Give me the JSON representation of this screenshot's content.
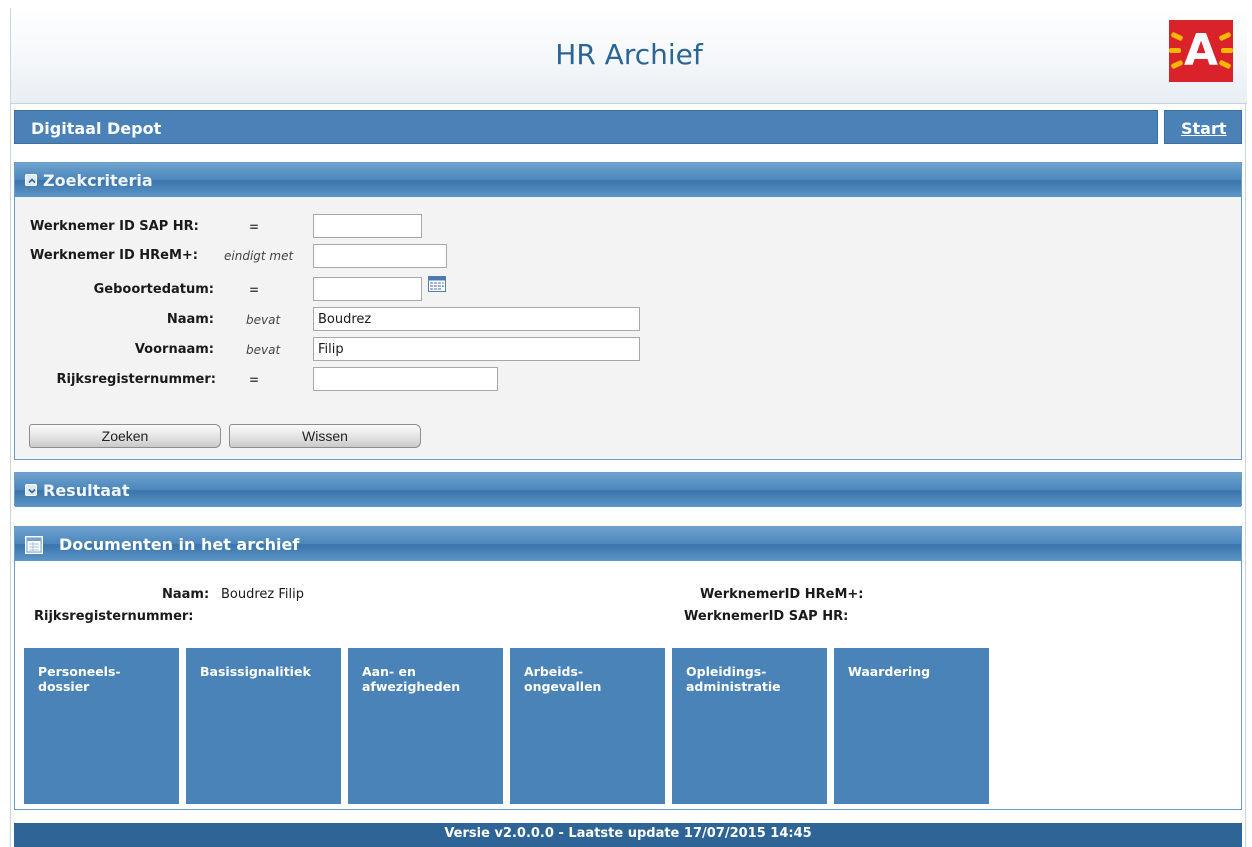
{
  "header": {
    "title": "HR Archief",
    "logo_letter": "A"
  },
  "nav": {
    "title": "Digitaal Depot",
    "start_link": "Start"
  },
  "search_panel": {
    "title": "Zoekcriteria",
    "fields": [
      {
        "label": "Werknemer ID SAP HR:",
        "operator": "=",
        "value": ""
      },
      {
        "label": "Werknemer ID HReM+:",
        "operator": "eindigt met",
        "value": ""
      },
      {
        "label": "Geboortedatum:",
        "operator": "=",
        "value": ""
      },
      {
        "label": "Naam:",
        "operator": "bevat",
        "value": "Boudrez"
      },
      {
        "label": "Voornaam:",
        "operator": "bevat",
        "value": "Filip"
      },
      {
        "label": "Rijksregisternummer:",
        "operator": "=",
        "value": ""
      }
    ],
    "buttons": {
      "search": "Zoeken",
      "clear": "Wissen"
    }
  },
  "result_panel": {
    "title": "Resultaat"
  },
  "documents_panel": {
    "title": "Documenten in het archief",
    "info": {
      "naam_label": "Naam:",
      "naam_value": "Boudrez Filip",
      "rijksregister_label": "Rijksregisternummer:",
      "rijksregister_value": "",
      "hrem_label": "WerknemerID HReM+:",
      "hrem_value": "",
      "sap_label": "WerknemerID SAP HR:",
      "sap_value": ""
    },
    "tiles": [
      {
        "label": "Personeels-\ndossier"
      },
      {
        "label": "Basissignalitiek"
      },
      {
        "label": "Aan- en\nafwezigheden"
      },
      {
        "label": "Arbeids-\nongevallen"
      },
      {
        "label": "Opleidings-\nadministratie"
      },
      {
        "label": "Waardering"
      }
    ]
  },
  "footer": {
    "text": "Versie v2.0.0.0 - Laatste update 17/07/2015 14:45"
  },
  "colors": {
    "accent": "#4a83b7",
    "logo": "#d9222a",
    "footer": "#2f6596"
  },
  "icons": {
    "collapse": "collapse-icon",
    "expand": "expand-icon",
    "calendar": "calendar-icon",
    "documents": "documents-icon"
  }
}
